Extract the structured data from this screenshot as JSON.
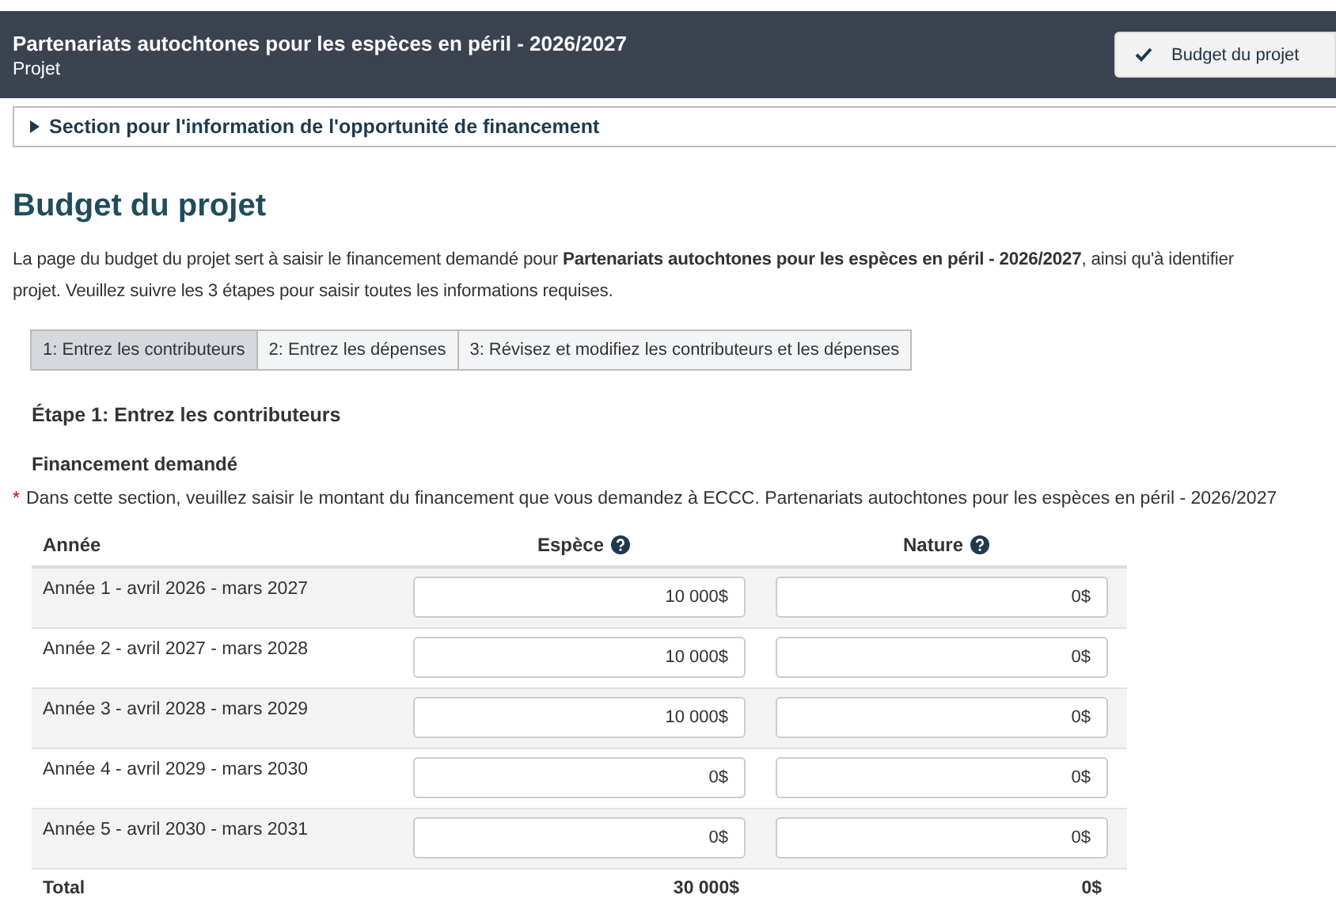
{
  "header": {
    "title": "Partenariats autochtones pour les espèces en péril - 2026/2027",
    "subtitle": "Projet",
    "button": "Budget du projet"
  },
  "section_toggle": {
    "label": "Section pour l'information de l'opportunité de financement",
    "expanded": false
  },
  "heading": "Budget du projet",
  "intro": [
    "La page du budget du projet sert à saisir le financement demandé pour **Partenariats autochtones pour les espèces en péril - 2026/2027**, ainsi qu'à identifier",
    "projet. Veuillez suivre les 3 étapes pour saisir toutes les informations requises."
  ],
  "tabs": [
    {
      "label": "1: Entrez les contributeurs",
      "selected": true
    },
    {
      "label": "2: Entrez les dépenses",
      "selected": false
    },
    {
      "label": "3: Révisez et modifiez les contributeurs et les dépenses",
      "selected": false
    }
  ],
  "step_title": "Étape 1: Entrez les contributeurs",
  "subsection": "Financement demandé",
  "required_mark": "*",
  "note": "Dans cette section, veuillez saisir le montant du financement que vous demandez à ECCC. Partenariats autochtones pour les espèces en péril - 2026/2027",
  "table": {
    "columns": [
      "Année",
      "Espèce",
      "Nature"
    ],
    "rows": [
      {
        "year": "Année 1 - avril 2026 - mars 2027",
        "espece": "10 000$",
        "nature": "0$"
      },
      {
        "year": "Année 2 - avril 2027 - mars 2028",
        "espece": "10 000$",
        "nature": "0$"
      },
      {
        "year": "Année 3 - avril 2028 - mars 2029",
        "espece": "10 000$",
        "nature": "0$"
      },
      {
        "year": "Année 4 - avril 2029 - mars 2030",
        "espece": "0$",
        "nature": "0$"
      },
      {
        "year": "Année 5 - avril 2030 - mars 2031",
        "espece": "0$",
        "nature": "0$"
      }
    ],
    "total": {
      "label": "Total",
      "espece": "30 000$",
      "nature": "0$"
    }
  }
}
